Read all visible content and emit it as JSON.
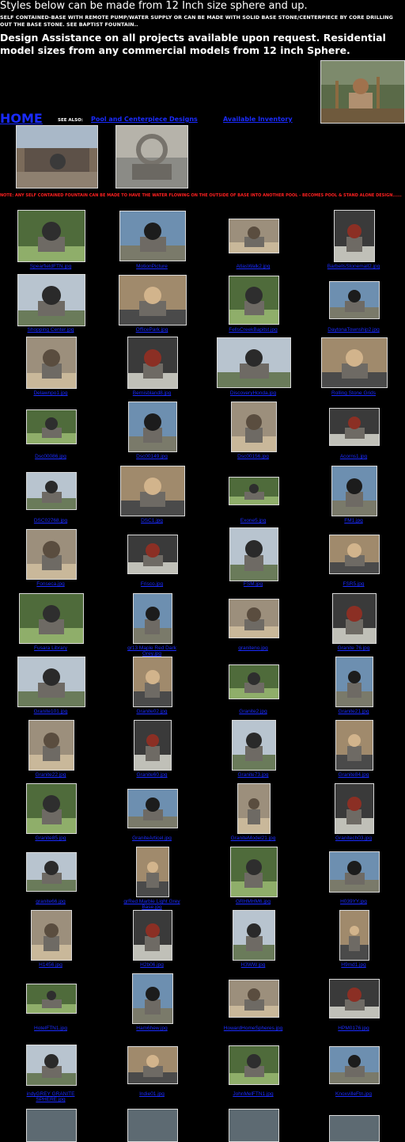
{
  "header": {
    "title": "Styles below can be made from 12 Inch size sphere and up.",
    "subtitle": "SELF CONTAINED-BASE WITH REMOTE PUMP/WATER SUPPLY OR CAN BE MADE WITH SOLID BASE STONE/CENTERPIECE BY CORE DRILLING OUT THE BASE STONE. SEE BAPTIST FOUNTAIN..",
    "assistance": "Design Assistance on all projects available upon request.  Residential model sizes from any commercial models from 12 inch Sphere."
  },
  "nav": {
    "home": "HOME",
    "see_also": "SEE ALSO:",
    "link1": "Pool and Centerpiece Designs",
    "link2": "Available Inventory"
  },
  "note": "NOTE: ANY SELF CONTAINED FOUNTAIN CAN BE MADE TO HAVE THE WATER FLOWING ON THE OUTSIDE OF BASE INTO ANOTHER POOL - BECOMES POOL & STAND ALONE DESIGN......",
  "colors": {
    "link": "#1a2bff",
    "note": "#ff2020",
    "background": "#000000"
  },
  "gallery": [
    {
      "caption": "SpearfieldFTN.jpg"
    },
    {
      "caption": "MotionPicture"
    },
    {
      "caption": "AtlasWalk2.jpg"
    },
    {
      "caption": "BarbellsStonemall2.jpg"
    },
    {
      "caption": "Shopping Center.jpg"
    },
    {
      "caption": "OfficePark.jpg"
    },
    {
      "caption": "FellsCreekBapitst.jpg"
    },
    {
      "caption": "DaytonaTownship2.jpg"
    },
    {
      "caption": "Delawnpo1.jpg"
    },
    {
      "caption": "Bernisbland8.jpg"
    },
    {
      "caption": "DiscoveryHonda.jpg"
    },
    {
      "caption": "Rolling Stone Grids"
    },
    {
      "caption": "Dsc00086.jpg"
    },
    {
      "caption": "Dsc00149.jpg"
    },
    {
      "caption": "Dsc00156.jpg"
    },
    {
      "caption": "Acorns1.jpg"
    },
    {
      "caption": "DSC02768.jpg"
    },
    {
      "caption": "DSC1.jpg"
    },
    {
      "caption": "Exone5.jpg"
    },
    {
      "caption": "FM1.jpg"
    },
    {
      "caption": "Fonseca.jpg"
    },
    {
      "caption": "Frisco.jpg"
    },
    {
      "caption": "FSM.jpg"
    },
    {
      "caption": "FSR5.jpg"
    },
    {
      "caption": "Fusara Library"
    },
    {
      "caption": "gr13 Maple Red Dark Grey.jpg"
    },
    {
      "caption": "graniteno.jpg"
    },
    {
      "caption": "Granite 76.jpg"
    },
    {
      "caption": "Granite101.jpg"
    },
    {
      "caption": "Granite02.jpg"
    },
    {
      "caption": "Granite2.jpg"
    },
    {
      "caption": "Granite21.jpg"
    },
    {
      "caption": "Granite22.jpg"
    },
    {
      "caption": "Granite60.jpg"
    },
    {
      "caption": "Granite73.jpg"
    },
    {
      "caption": "Granite84.jpg"
    },
    {
      "caption": "Granite85.jpg"
    },
    {
      "caption": "GraniteArticel.jpg"
    },
    {
      "caption": "GraniteModel21.jpg"
    },
    {
      "caption": "Granitech03.jpg"
    },
    {
      "caption": "granite66.jpg"
    },
    {
      "caption": "grRed Marble Light Grey Base.jpg"
    },
    {
      "caption": "GRHMHM6.jpg"
    },
    {
      "caption": "H039YY.jpg"
    },
    {
      "caption": "H1456.jpg"
    },
    {
      "caption": "H2b06.jpg"
    },
    {
      "caption": "H3WW.jpg"
    },
    {
      "caption": "H9md1.jpg"
    },
    {
      "caption": "HotelFTN1.jpg"
    },
    {
      "caption": "Ham6hew.jpg"
    },
    {
      "caption": "HowardHomeSpheres.jpg"
    },
    {
      "caption": "HPM0176.jpg"
    },
    {
      "caption": "indyGREY GRANITE SPHERE.jpg"
    },
    {
      "caption": "Indie01.jpg"
    },
    {
      "caption": "JohnMelFTN1.jpg"
    },
    {
      "caption": "KnoxvilleFtn.jpg"
    }
  ]
}
